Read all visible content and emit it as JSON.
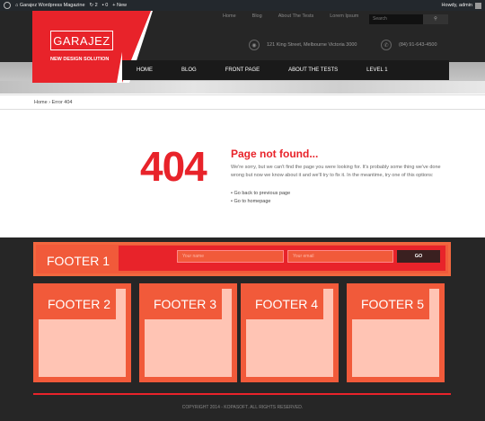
{
  "adminbar": {
    "site_name": "Garajez Wordpress Magazine",
    "updates": "2",
    "comments": "0",
    "new": "+ New",
    "howdy": "Howdy, admin"
  },
  "header": {
    "logo": "GARAJEZ",
    "tagline": "NEW DESIGN SOLUTION",
    "top_menu": [
      "Home",
      "Blog",
      "About The Tests",
      "Lorem Ipsum"
    ],
    "search_placeholder": "Search",
    "address": "121 King Street, Melbourne Victoria 3000",
    "phone": "(84) 91-643-4500",
    "nav": [
      "HOME",
      "BLOG",
      "FRONT PAGE",
      "ABOUT THE TESTS",
      "LEVEL 1"
    ]
  },
  "breadcrumb": "Home › Error 404",
  "error": {
    "code": "404",
    "title": "Page not found...",
    "text": "We're sorry, but we can't find the page you were looking for. It's probably some thing we've done wrong but now we know about it and we'll try to fix it. In the meantime, try one of this options:",
    "links": [
      "Go back to previous page",
      "Go to homepage"
    ]
  },
  "footer": {
    "f1_label": "FOOTER 1",
    "name_placeholder": "Your name",
    "email_placeholder": "Your email",
    "go": "GO",
    "blocks": [
      "FOOTER 2",
      "FOOTER 3",
      "FOOTER 4",
      "FOOTER 5"
    ],
    "copyright": "COPYRIGHT 2014 - KOPASOFT. ALL RIGHTS RESERVED."
  },
  "colors": {
    "accent": "#e8232a",
    "footer_orange": "#f15a3a",
    "footer_bg": "#262626"
  }
}
